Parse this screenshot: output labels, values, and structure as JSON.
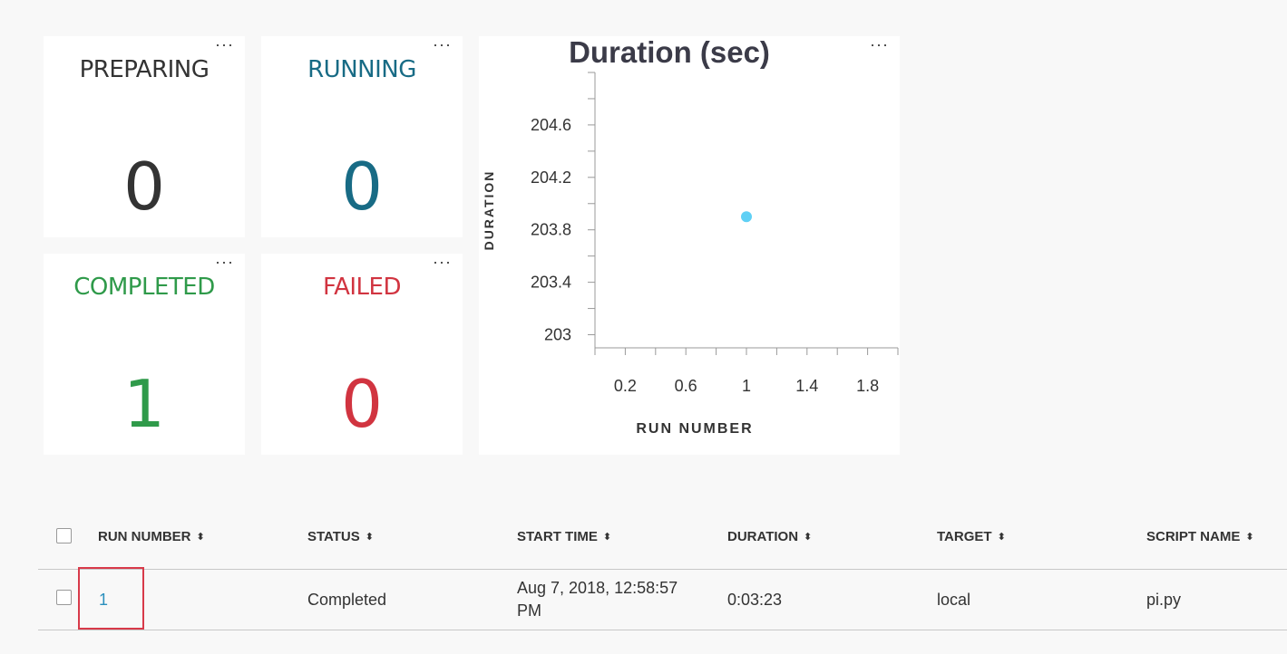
{
  "tiles": {
    "preparing": {
      "label": "PREPARING",
      "value": "0",
      "color": "#333333"
    },
    "running": {
      "label": "RUNNING",
      "value": "0",
      "color": "#186b85"
    },
    "completed": {
      "label": "COMPLETED",
      "value": "1",
      "color": "#2f9a4a"
    },
    "failed": {
      "label": "FAILED",
      "value": "0",
      "color": "#d13440"
    },
    "menu_glyph": "···"
  },
  "chart_data": {
    "type": "scatter",
    "title": "Duration (sec)",
    "xlabel": "RUN NUMBER",
    "ylabel": "DURATION",
    "x_ticks": [
      0.2,
      0.6,
      1,
      1.4,
      1.8
    ],
    "y_ticks": [
      203,
      203.4,
      203.8,
      204.2,
      204.6
    ],
    "xlim": [
      0,
      2
    ],
    "ylim": [
      202.9,
      205
    ],
    "points": [
      {
        "x": 1,
        "y": 203.9
      }
    ],
    "point_color": "#5fd0f5"
  },
  "table": {
    "columns": [
      "RUN NUMBER",
      "STATUS",
      "START TIME",
      "DURATION",
      "TARGET",
      "SCRIPT NAME"
    ],
    "sort_glyph": "⬍",
    "rows": [
      {
        "run_number": "1",
        "status": "Completed",
        "start_time_line1": "Aug 7, 2018, 12:58:57",
        "start_time_line2": "PM",
        "duration": "0:03:23",
        "target": "local",
        "script_name": "pi.py"
      }
    ]
  }
}
